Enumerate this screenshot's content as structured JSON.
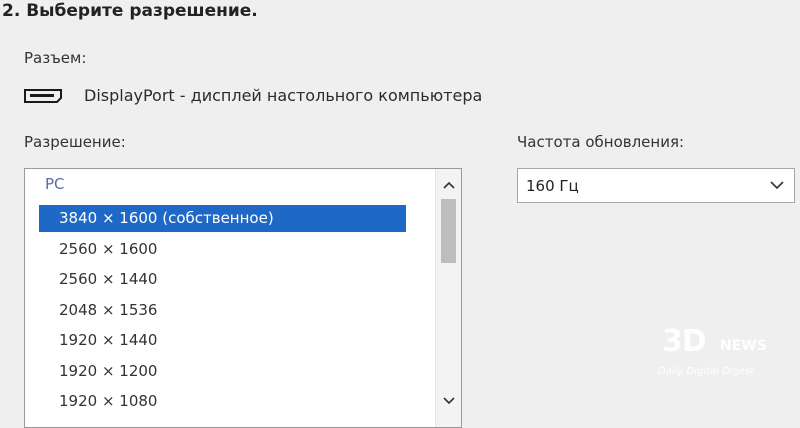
{
  "step_title": "2. Выберите разрешение.",
  "connector": {
    "label": "Разъем:",
    "icon": "displayport-icon",
    "name": "DisplayPort - дисплей настольного компьютера"
  },
  "resolution": {
    "label": "Разрешение:",
    "group": "PC",
    "items": [
      "3840 × 1600 (собственное)",
      "2560 × 1600",
      "2560 × 1440",
      "2048 × 1536",
      "1920 × 1440",
      "1920 × 1200",
      "1920 × 1080"
    ],
    "selected_index": 0
  },
  "refresh": {
    "label": "Частота обновления:",
    "value": "160 Гц"
  },
  "watermark": {
    "brand": "3D",
    "news": "NEWS",
    "tagline": "Daily Digital Digest"
  },
  "colors": {
    "selection": "#1f69c6",
    "background": "#f0eff0"
  }
}
